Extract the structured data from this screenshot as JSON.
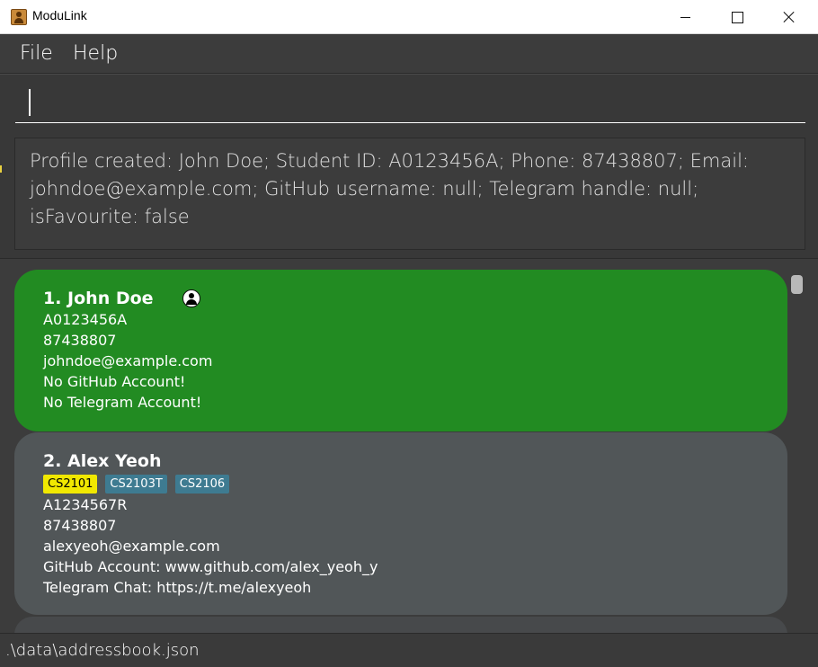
{
  "window": {
    "title": "ModuLink",
    "app_icon": "address-book-icon"
  },
  "menu": {
    "file_label": "File",
    "help_label": "Help"
  },
  "command": {
    "value": "",
    "placeholder": ""
  },
  "result": {
    "text": "Profile created: John Doe; Student ID: A0123456A; Phone: 87438807; Email: johndoe@example.com; GitHub username: null; Telegram handle: null; isFavourite: false"
  },
  "persons": [
    {
      "name": "1. John Doe",
      "favourite_icon": "user-profile-icon",
      "student_id": "A0123456A",
      "phone": "87438807",
      "email": "johndoe@example.com",
      "github": "No GitHub Account!",
      "telegram": "No Telegram Account!",
      "card_color": "#228b22"
    },
    {
      "name": "2. Alex Yeoh",
      "tags": [
        {
          "label": "CS2101",
          "color": "#f1e800"
        },
        {
          "label": "CS2103T",
          "color": "#3e7b91"
        },
        {
          "label": "CS2106",
          "color": "#3e7b91"
        }
      ],
      "student_id": "A1234567R",
      "phone": "87438807",
      "email": "alexyeoh@example.com",
      "github": "GitHub Account: www.github.com/alex_yeoh_y",
      "telegram": "Telegram Chat: https://t.me/alexyeoh",
      "card_color": "#515658"
    }
  ],
  "status": {
    "file_path": ".\\data\\addressbook.json"
  }
}
